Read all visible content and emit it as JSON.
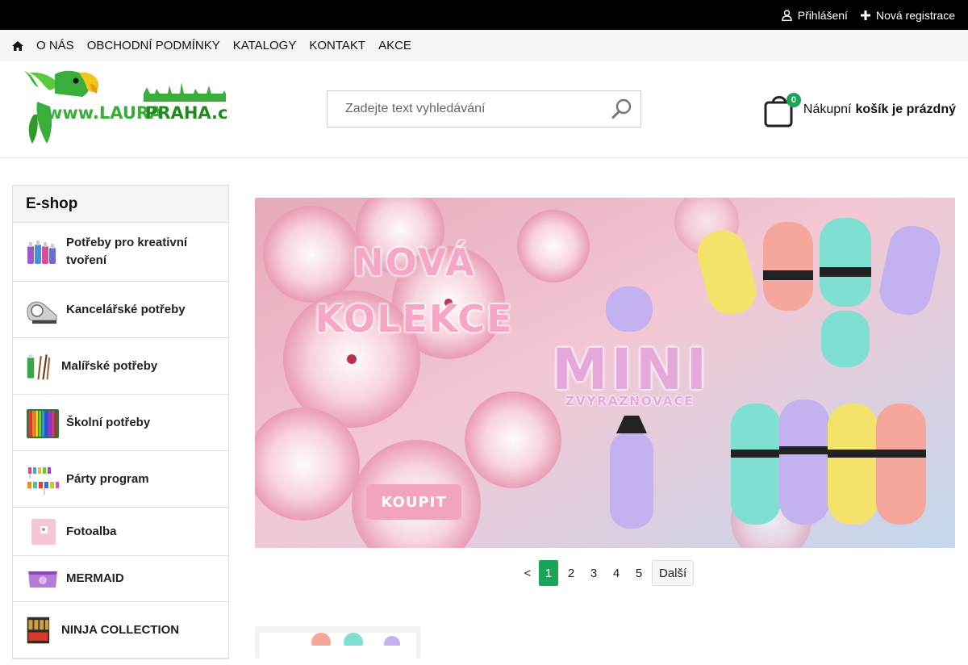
{
  "topbar": {
    "login": "Přihlášení",
    "register": "Nová registrace"
  },
  "nav": {
    "items": [
      "O NÁS",
      "OBCHODNÍ PODMÍNKY",
      "KATALOGY",
      "KONTAKT",
      "AKCE"
    ]
  },
  "header": {
    "logo_text": "www.LAURAPRAHA.cz",
    "search_placeholder": "Zadejte text vyhledávání",
    "cart_count": "0",
    "cart_prefix": "Nákupní",
    "cart_status": "košík je prázdný"
  },
  "sidebar": {
    "title": "E-shop",
    "items": [
      {
        "label": "Potřeby pro kreativní tvoření"
      },
      {
        "label": "Kancelářské potřeby"
      },
      {
        "label": "Malířské potřeby"
      },
      {
        "label": "Školní potřeby"
      },
      {
        "label": "Párty program"
      },
      {
        "label": "Fotoalba"
      },
      {
        "label": "MERMAID"
      },
      {
        "label": "NINJA COLLECTION"
      }
    ]
  },
  "banner": {
    "line1": "NOVÁ",
    "line2": "KOLEKCE",
    "mini": "MINI",
    "sub": "ZVÝRAZŇOVAČE",
    "cta": "KOUPIT"
  },
  "pagination": {
    "prev": "<",
    "pages": [
      "1",
      "2",
      "3",
      "4",
      "5"
    ],
    "current": "1",
    "next": "Další"
  },
  "colors": {
    "accent": "#1aa556",
    "topbar": "#000000",
    "nav_bg": "#f5f5f5"
  }
}
